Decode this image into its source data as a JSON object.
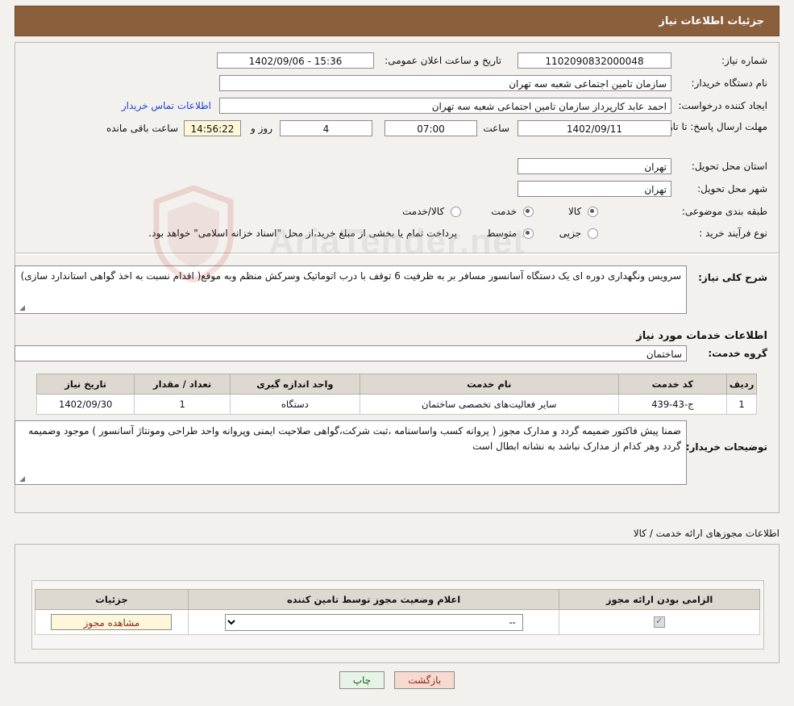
{
  "header": {
    "title": "جزئیات اطلاعات نیاز"
  },
  "fields": {
    "need_number_label": "شماره نیاز:",
    "need_number_value": "1102090832000048",
    "announce_datetime_label": "تاریخ و ساعت اعلان عمومی:",
    "announce_datetime_value": "15:36 - 1402/09/06",
    "buyer_org_label": "نام دستگاه خریدار:",
    "buyer_org_value": "سازمان تامین اجتماعی شعبه سه تهران",
    "requester_label": "ایجاد کننده درخواست:",
    "requester_value": "احمد عابد کارپرداز سازمان تامین اجتماعی شعبه سه تهران",
    "contact_link": "اطلاعات تماس خریدار",
    "deadline_label": "مهلت ارسال پاسخ: تا تاریخ:",
    "deadline_date": "1402/09/11",
    "hour_label": "ساعت",
    "deadline_hour": "07:00",
    "days_value": "4",
    "days_label": "روز و",
    "remaining_time": "14:56:22",
    "remaining_label": "ساعت باقی مانده",
    "province_label": "استان محل تحویل:",
    "province_value": "تهران",
    "city_label": "شهر محل تحویل:",
    "city_value": "تهران",
    "category_label": "طبقه بندی موضوعی:",
    "category_options": [
      {
        "label": "کالا",
        "selected": false
      },
      {
        "label": "خدمت",
        "selected": true
      },
      {
        "label": "کالا/خدمت",
        "selected": false
      }
    ],
    "process_label": "نوع فرآیند خرید :",
    "process_options": [
      {
        "label": "جزیی",
        "selected": false
      },
      {
        "label": "متوسط",
        "selected": true
      }
    ],
    "process_note": "پرداخت تمام یا بخشی از مبلغ خرید،از محل \"اسناد خزانه اسلامی\" خواهد بود."
  },
  "description": {
    "label": "شرح کلی نیاز:",
    "value": "سرویس ونگهداری دوره ای یک دستگاه آسانسور مسافر بر به ظرفیت 6 توقف با درب اتوماتیک  وسرکش منظم وبه موقع( اقدام نسبت به اخذ گواهی استاندارد سازی)"
  },
  "service_section": {
    "heading": "اطلاعات خدمات مورد نیاز",
    "group_label": "گروه خدمت:",
    "group_value": "ساختمان",
    "table": {
      "headers": [
        "ردیف",
        "کد خدمت",
        "نام خدمت",
        "واحد اندازه گیری",
        "تعداد / مقدار",
        "تاریخ نیاز"
      ],
      "rows": [
        [
          "1",
          "ج-43-439",
          "سایر فعالیت‌های تخصصی ساختمان",
          "دستگاه",
          "1",
          "1402/09/30"
        ]
      ]
    }
  },
  "buyer_notes": {
    "label": "توضیحات خریدار:",
    "value": "ضمنا پیش فاکتور ضمیمه گردد و مدارک مجوز ( پروانه کسب واساسنامه ،ثبت شرکت،گواهی صلاحیت ایمنی وپروانه واحد طراحی ومونتاژ آسانسور ) موجود  وضمیمه گردد وهر کدام از مدارک نباشد به نشانه ابطال است"
  },
  "licenses": {
    "section_label": "اطلاعات مجوزهای ارائه خدمت / کالا",
    "headers": [
      "الزامی بودن ارائه مجوز",
      "اعلام وضعیت مجوز توسط تامین کننده",
      "جزئیات"
    ],
    "rows": [
      {
        "required_checked": true,
        "status_value": "--",
        "detail_label": "مشاهده مجوز"
      }
    ]
  },
  "footer": {
    "print_label": "چاپ",
    "back_label": "بازگشت"
  },
  "watermark": {
    "text": "AriaTender.net"
  }
}
